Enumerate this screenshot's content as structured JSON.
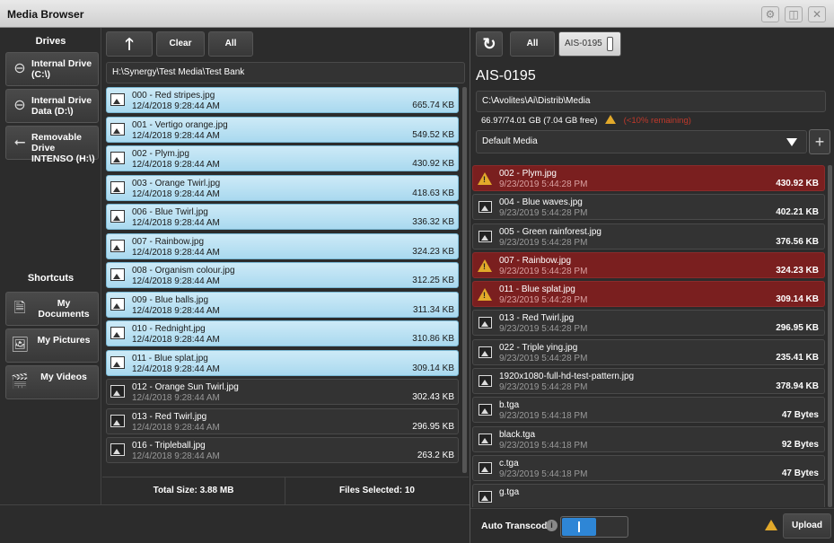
{
  "window": {
    "title": "Media Browser"
  },
  "drives": {
    "header": "Drives",
    "items": [
      {
        "label": "Internal Drive (C:\\)",
        "icon": "hard-drive-icon"
      },
      {
        "label": "Internal Drive Data (D:\\)",
        "icon": "hard-drive-icon"
      },
      {
        "label": "Removable Drive INTENSO (H:\\)",
        "icon": "usb-icon"
      }
    ]
  },
  "shortcuts": {
    "header": "Shortcuts",
    "items": [
      {
        "label": "My Documents",
        "icon": "document-icon"
      },
      {
        "label": "My Pictures",
        "icon": "picture-icon"
      },
      {
        "label": "My Videos",
        "icon": "video-icon"
      }
    ]
  },
  "source": {
    "toolbar": {
      "up_icon": "up-arrow-icon",
      "clear": "Clear",
      "all": "All"
    },
    "path": "H:\\Synergy\\Test Media\\Test Bank",
    "files": [
      {
        "name": "000 - Red stripes.jpg",
        "date": "12/4/2018 9:28:44 AM",
        "size": "665.74 KB",
        "selected": true
      },
      {
        "name": "001 - Vertigo orange.jpg",
        "date": "12/4/2018 9:28:44 AM",
        "size": "549.52 KB",
        "selected": true
      },
      {
        "name": "002 - Plym.jpg",
        "date": "12/4/2018 9:28:44 AM",
        "size": "430.92 KB",
        "selected": true
      },
      {
        "name": "003 - Orange Twirl.jpg",
        "date": "12/4/2018 9:28:44 AM",
        "size": "418.63 KB",
        "selected": true
      },
      {
        "name": "006 - Blue Twirl.jpg",
        "date": "12/4/2018 9:28:44 AM",
        "size": "336.32 KB",
        "selected": true
      },
      {
        "name": "007 - Rainbow.jpg",
        "date": "12/4/2018 9:28:44 AM",
        "size": "324.23 KB",
        "selected": true
      },
      {
        "name": "008 - Organism colour.jpg",
        "date": "12/4/2018 9:28:44 AM",
        "size": "312.25 KB",
        "selected": true
      },
      {
        "name": "009 - Blue balls.jpg",
        "date": "12/4/2018 9:28:44 AM",
        "size": "311.34 KB",
        "selected": true
      },
      {
        "name": "010 - Rednight.jpg",
        "date": "12/4/2018 9:28:44 AM",
        "size": "310.86 KB",
        "selected": true
      },
      {
        "name": "011 - Blue splat.jpg",
        "date": "12/4/2018 9:28:44 AM",
        "size": "309.14 KB",
        "selected": true
      },
      {
        "name": "012 - Orange Sun Twirl.jpg",
        "date": "12/4/2018 9:28:44 AM",
        "size": "302.43 KB",
        "selected": false
      },
      {
        "name": "013 - Red Twirl.jpg",
        "date": "12/4/2018 9:28:44 AM",
        "size": "296.95 KB",
        "selected": false
      },
      {
        "name": "016 - Tripleball.jpg",
        "date": "12/4/2018 9:28:44 AM",
        "size": "263.2 KB",
        "selected": false
      }
    ],
    "footer": {
      "total": "Total Size: 3.88 MB",
      "selected": "Files Selected: 10"
    }
  },
  "target": {
    "toolbar": {
      "refresh_icon": "refresh-icon",
      "all": "All",
      "device": "AIS-0195"
    },
    "name": "AIS-0195",
    "path": "C:\\Avolites\\Ai\\Distrib\\Media",
    "space": "66.97/74.01 GB (7.04 GB free)",
    "space_warning": "(<10% remaining)",
    "folder": "Default Media",
    "files": [
      {
        "name": "002 - Plym.jpg",
        "date": "9/23/2019 5:44:28 PM",
        "size": "430.92 KB",
        "status": "error"
      },
      {
        "name": "004 - Blue waves.jpg",
        "date": "9/23/2019 5:44:28 PM",
        "size": "402.21 KB",
        "status": "ok"
      },
      {
        "name": "005 - Green rainforest.jpg",
        "date": "9/23/2019 5:44:28 PM",
        "size": "376.56 KB",
        "status": "ok"
      },
      {
        "name": "007 - Rainbow.jpg",
        "date": "9/23/2019 5:44:28 PM",
        "size": "324.23 KB",
        "status": "error"
      },
      {
        "name": "011 - Blue splat.jpg",
        "date": "9/23/2019 5:44:28 PM",
        "size": "309.14 KB",
        "status": "error"
      },
      {
        "name": "013 - Red Twirl.jpg",
        "date": "9/23/2019 5:44:28 PM",
        "size": "296.95 KB",
        "status": "ok"
      },
      {
        "name": "022 - Triple ying.jpg",
        "date": "9/23/2019 5:44:28 PM",
        "size": "235.41 KB",
        "status": "ok"
      },
      {
        "name": "1920x1080-full-hd-test-pattern.jpg",
        "date": "9/23/2019 5:44:28 PM",
        "size": "378.94 KB",
        "status": "ok"
      },
      {
        "name": "b.tga",
        "date": "9/23/2019 5:44:18 PM",
        "size": "47 Bytes",
        "status": "ok"
      },
      {
        "name": "black.tga",
        "date": "9/23/2019 5:44:18 PM",
        "size": "92 Bytes",
        "status": "ok"
      },
      {
        "name": "c.tga",
        "date": "9/23/2019 5:44:18 PM",
        "size": "47 Bytes",
        "status": "ok"
      },
      {
        "name": "g.tga",
        "date": "",
        "size": "",
        "status": "ok"
      }
    ],
    "auto_transcode": "Auto Transcode",
    "auto_transcode_on": true,
    "upload": "Upload"
  },
  "colors": {
    "selected_row": "#bfe3f4",
    "error_row": "#7a1f1f",
    "warning": "#e2a92a",
    "toggle_on": "#2e86d6"
  }
}
